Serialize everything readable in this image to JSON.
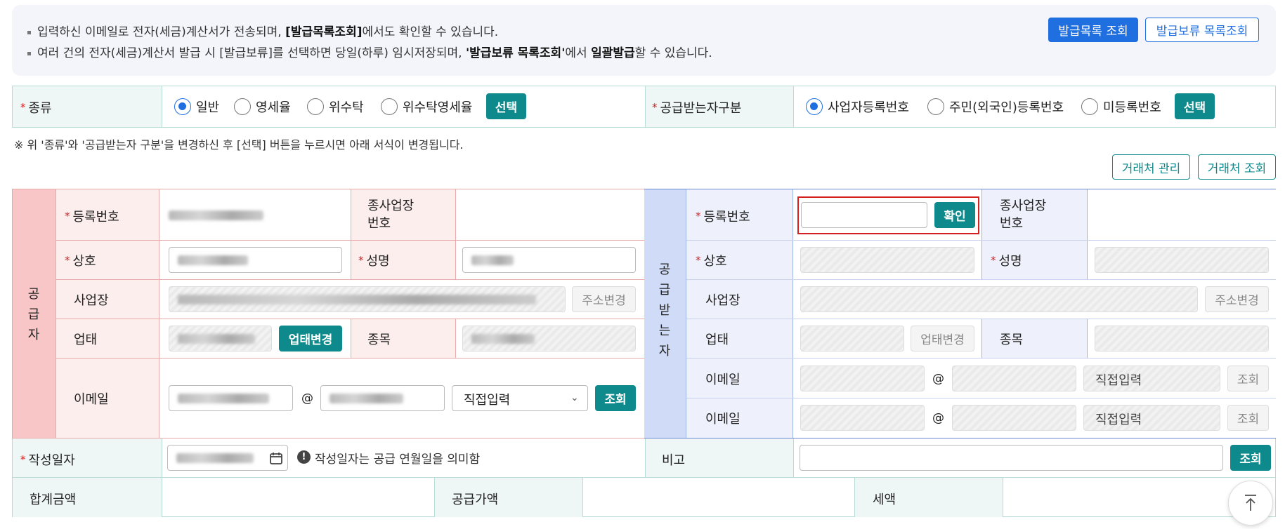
{
  "notice": {
    "line1_pre": "입력하신 이메일로 전자(세금)계산서가 전송되며, ",
    "line1_bold": "[발급목록조회]",
    "line1_post": "에서도 확인할 수 있습니다.",
    "line2_pre": "여러 건의 전자(세금)계산서 발급 시 [발급보류]를 선택하면 당일(하루) 임시저장되며, ",
    "line2_bold": "'발급보류 목록조회'",
    "line2_mid": "에서 ",
    "line2_bold2": "일괄발급",
    "line2_post": "할 수 있습니다.",
    "btn_issue_list": "발급목록 조회",
    "btn_hold_list": "발급보류 목록조회"
  },
  "type_row": {
    "type_label": "종류",
    "type_options": [
      "일반",
      "영세율",
      "위수탁",
      "위수탁영세율"
    ],
    "type_selected": "일반",
    "select_btn": "선택",
    "recipient_label": "공급받는자구분",
    "recipient_options": [
      "사업자등록번호",
      "주민(외국인)등록번호",
      "미등록번호"
    ],
    "recipient_selected": "사업자등록번호"
  },
  "change_note": "※ 위 '종류'와 '공급받는자 구분'을 변경하신 후 [선택] 버튼을 누르시면 아래 서식이 변경됩니다.",
  "partner": {
    "manage": "거래처 관리",
    "search": "거래처 조회"
  },
  "supplier": {
    "side_title": "공급자",
    "reg_no": "등록번호",
    "branch_no": "종사업장 번호",
    "company": "상호",
    "name": "성명",
    "address": "사업장",
    "addr_change": "주소변경",
    "biz_type": "업태",
    "biz_type_change": "업태변경",
    "item": "종목",
    "email": "이메일",
    "at": "@",
    "domain_select": "직접입력",
    "lookup": "조회"
  },
  "receiver": {
    "side_title": "공급받는자",
    "reg_no": "등록번호",
    "confirm": "확인",
    "branch_no": "종사업장 번호",
    "company": "상호",
    "name": "성명",
    "address": "사업장",
    "addr_change": "주소변경",
    "biz_type": "업태",
    "biz_type_change": "업태변경",
    "item": "종목",
    "email": "이메일",
    "at": "@",
    "domain_select": "직접입력",
    "lookup": "조회"
  },
  "bottom": {
    "write_date": "작성일자",
    "date_hint": "작성일자는 공급 연월일을 의미함",
    "remark": "비고",
    "remark_lookup": "조회",
    "total": "합계금액",
    "supply": "공급가액",
    "tax": "세액"
  },
  "colors": {
    "accent_teal": "#0e8a8c",
    "accent_blue": "#1f6fe0",
    "supplier_bg": "#fdeeee",
    "supplier_side": "#f8c6c6",
    "receiver_bg": "#eef0fb",
    "receiver_side": "#cfdbf7",
    "highlight": "#d32020"
  }
}
